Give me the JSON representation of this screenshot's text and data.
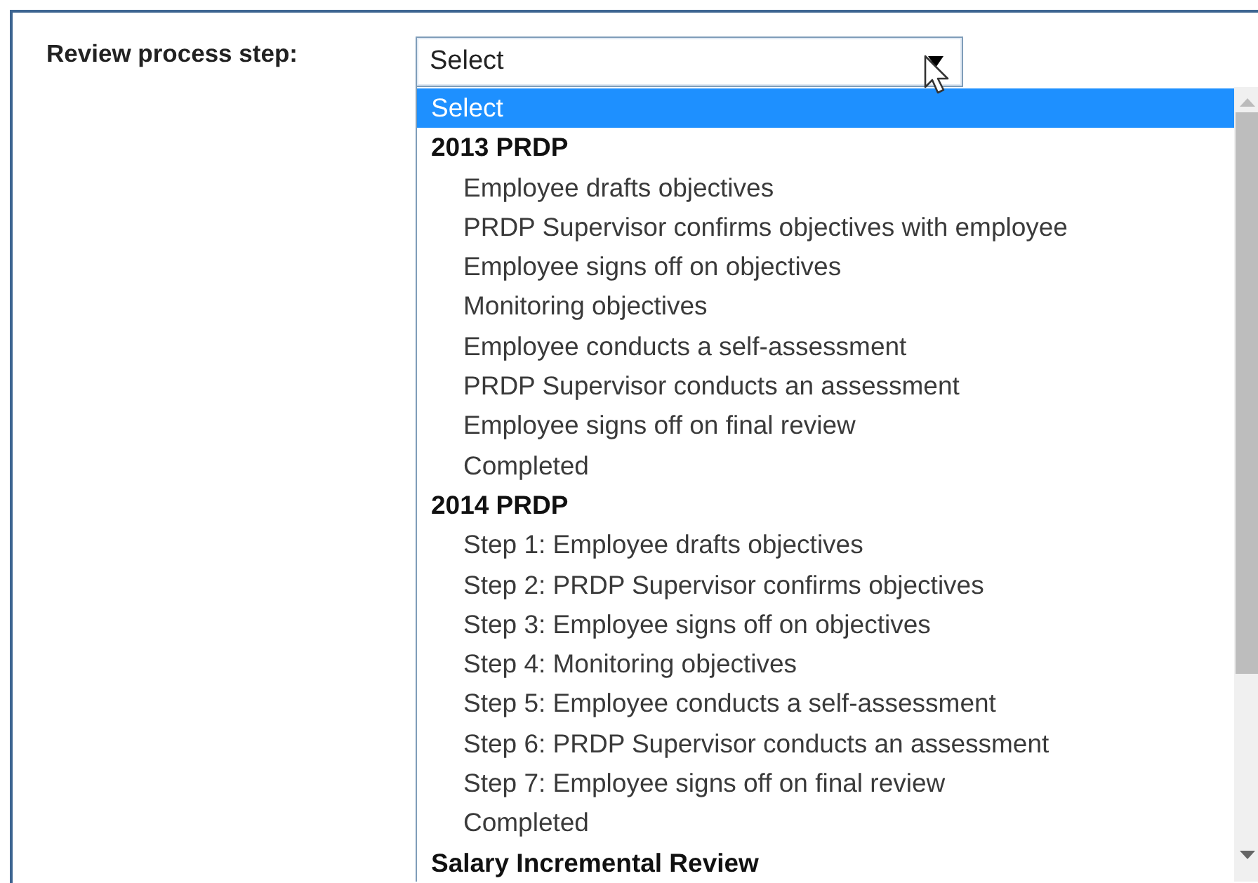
{
  "field": {
    "label": "Review process step:",
    "value": "Select"
  },
  "dropdown": {
    "items": [
      {
        "kind": "option",
        "label": "Select",
        "selected": true
      },
      {
        "kind": "group",
        "label": "2013 PRDP",
        "children": [
          {
            "kind": "option",
            "label": "Employee drafts objectives",
            "selected": false
          },
          {
            "kind": "option",
            "label": "PRDP Supervisor confirms objectives with employee",
            "selected": false
          },
          {
            "kind": "option",
            "label": "Employee signs off on objectives",
            "selected": false
          },
          {
            "kind": "option",
            "label": "Monitoring objectives",
            "selected": false
          },
          {
            "kind": "option",
            "label": "Employee conducts a self-assessment",
            "selected": false
          },
          {
            "kind": "option",
            "label": "PRDP Supervisor conducts an assessment",
            "selected": false
          },
          {
            "kind": "option",
            "label": "Employee signs off on final review",
            "selected": false
          },
          {
            "kind": "option",
            "label": "Completed",
            "selected": false
          }
        ]
      },
      {
        "kind": "group",
        "label": "2014 PRDP",
        "children": [
          {
            "kind": "option",
            "label": "Step 1: Employee drafts objectives",
            "selected": false
          },
          {
            "kind": "option",
            "label": "Step 2: PRDP Supervisor confirms objectives",
            "selected": false
          },
          {
            "kind": "option",
            "label": "Step 3: Employee signs off on objectives",
            "selected": false
          },
          {
            "kind": "option",
            "label": "Step 4: Monitoring objectives",
            "selected": false
          },
          {
            "kind": "option",
            "label": "Step 5: Employee conducts a self-assessment",
            "selected": false
          },
          {
            "kind": "option",
            "label": "Step 6: PRDP Supervisor conducts an assessment",
            "selected": false
          },
          {
            "kind": "option",
            "label": "Step 7: Employee signs off on final review",
            "selected": false
          },
          {
            "kind": "option",
            "label": "Completed",
            "selected": false
          }
        ]
      },
      {
        "kind": "group",
        "label": "Salary Incremental Review"
      }
    ]
  }
}
